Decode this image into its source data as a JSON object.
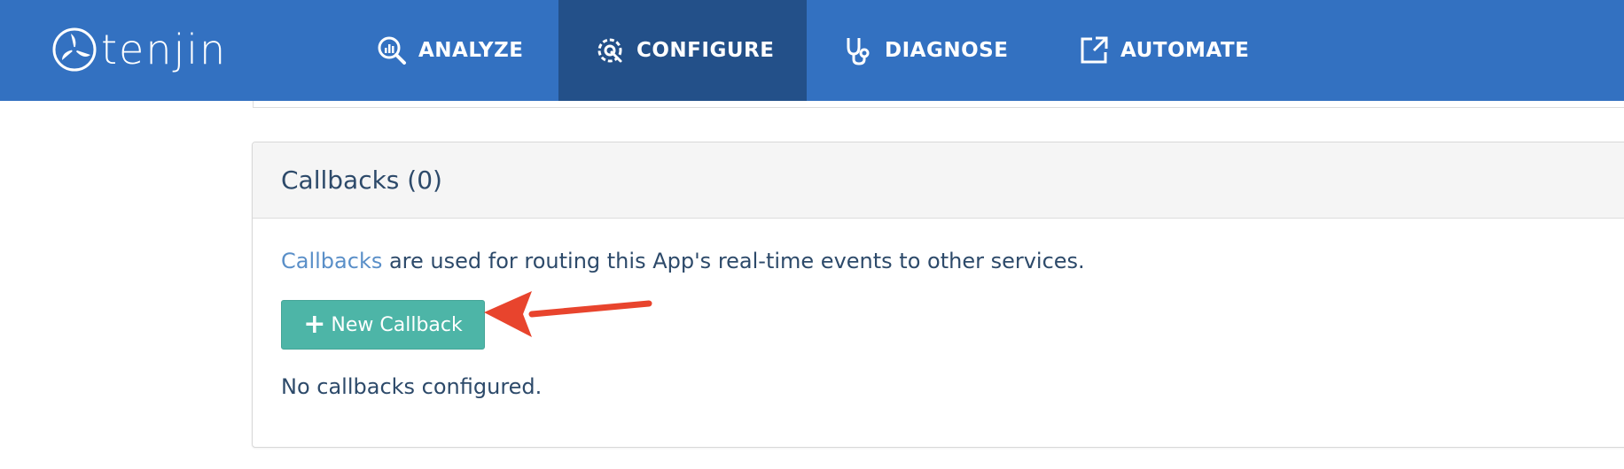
{
  "brand": {
    "name": "tenjin"
  },
  "nav": {
    "items": [
      {
        "label": "ANALYZE",
        "icon": "analyze-icon",
        "active": false
      },
      {
        "label": "CONFIGURE",
        "icon": "configure-icon",
        "active": true
      },
      {
        "label": "DIAGNOSE",
        "icon": "stethoscope-icon",
        "active": false
      },
      {
        "label": "AUTOMATE",
        "icon": "external-link-icon",
        "active": false
      }
    ]
  },
  "panel": {
    "title": "Callbacks (0)",
    "description_link": "Callbacks",
    "description_rest": " are used for routing this App's real-time events to other services.",
    "button_plus": "+",
    "button_label": "New Callback",
    "empty_message": "No callbacks configured."
  },
  "colors": {
    "nav_bg": "#3371c1",
    "nav_active_bg": "#235089",
    "button_bg": "#4db5a7",
    "link": "#5a8fc8",
    "text": "#2d4a6a",
    "annotation_arrow": "#e8442d"
  }
}
